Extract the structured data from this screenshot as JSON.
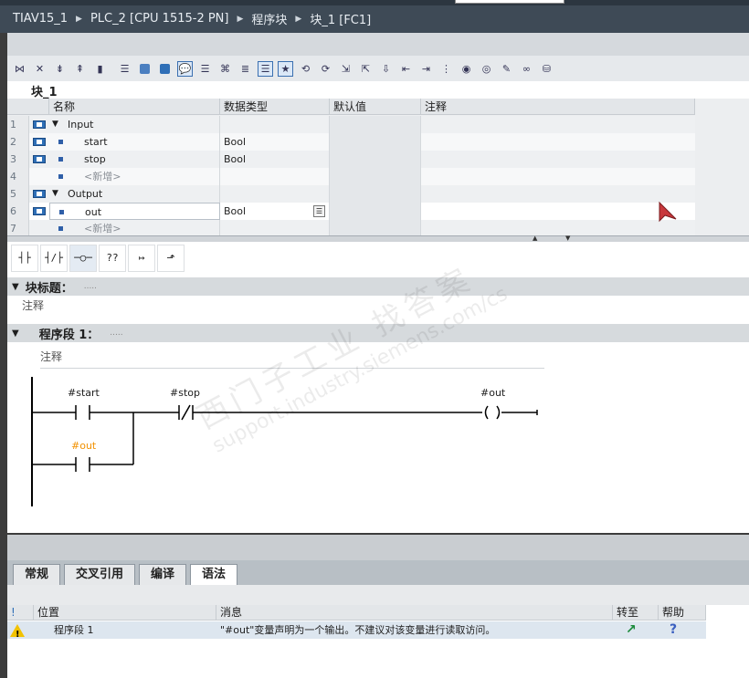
{
  "breadcrumb": [
    "TIAV15_1",
    "PLC_2 [CPU 1515-2 PN]",
    "程序块",
    "块_1 [FC1]"
  ],
  "editor": {
    "block_name": "块_1",
    "interface_headers": [
      "名称",
      "数据类型",
      "默认值",
      "注释"
    ],
    "rows": [
      {
        "num": "1",
        "name": "Input",
        "type": "",
        "section": true
      },
      {
        "num": "2",
        "name": "start",
        "type": "Bool"
      },
      {
        "num": "3",
        "name": "stop",
        "type": "Bool"
      },
      {
        "num": "4",
        "name": "<新增>",
        "type": "",
        "ghost": true
      },
      {
        "num": "5",
        "name": "Output",
        "type": "",
        "section": true
      },
      {
        "num": "6",
        "name": "out",
        "type": "Bool"
      },
      {
        "num": "7",
        "name": "<新增>",
        "type": "",
        "ghost": true
      }
    ],
    "block_title_label": "块标题：",
    "block_title_dots": ".....",
    "block_comment": "注释",
    "network_label": "程序段 1：",
    "network_dots": ".....",
    "network_comment": "注释",
    "ladder": {
      "contact_start": "#start",
      "contact_stop": "#stop",
      "coil_out": "#out",
      "contact_out": "#out"
    },
    "ladder_toolbar": [
      "┤├",
      "┤/├",
      "─○─",
      "??",
      "↦",
      "⬏"
    ]
  },
  "inspector": {
    "tabs": [
      "常规",
      "交叉引用",
      "编译",
      "语法"
    ],
    "active_tab": "语法",
    "columns": [
      "!",
      "位置",
      "消息",
      "转至",
      "帮助"
    ],
    "messages": [
      {
        "location": "程序段 1",
        "message": "\"#out\"变量声明为一个输出。不建议对该变量进行读取访问。",
        "goto": "↗",
        "help": "?"
      }
    ]
  },
  "watermark": {
    "line1": "西门子工业  找答案",
    "line2": "support.industry.siemens.com/cs"
  },
  "colors": {
    "title_bg": "#3e4a56",
    "accent_blue": "#2f6fb7",
    "warning": "#f2c200",
    "coil_orange": "#f29100"
  }
}
